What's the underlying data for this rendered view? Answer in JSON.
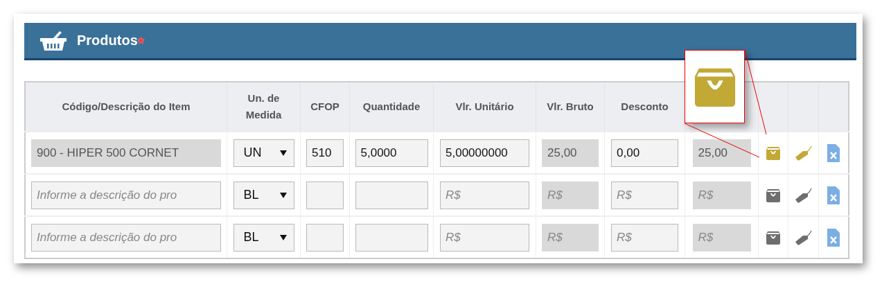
{
  "panel": {
    "title": "Produtos",
    "required_mark": "*"
  },
  "table": {
    "columns": [
      "Código/Descrição do Item",
      "Un. de Medida",
      "CFOP",
      "Quantidade",
      "Vlr. Unitário",
      "Vlr. Bruto",
      "Desconto"
    ],
    "rows": [
      {
        "highlighted": true,
        "description": {
          "value": "900 - HIPER 500 CORNET",
          "disabled": true
        },
        "unit": "UN",
        "cfop": {
          "value": "510"
        },
        "quantity": {
          "value": "5,0000"
        },
        "unit_price": {
          "value": "5,00000000"
        },
        "gross": {
          "value": "25,00"
        },
        "discount": {
          "value": "0,00"
        },
        "total": {
          "value": "25,00"
        }
      },
      {
        "highlighted": false,
        "description": {
          "placeholder": "Informe a descrição do pro",
          "disabled": false
        },
        "unit": "BL",
        "cfop": {},
        "quantity": {},
        "unit_price": {
          "placeholder": "R$"
        },
        "gross": {
          "placeholder": "R$"
        },
        "discount": {
          "placeholder": "R$"
        },
        "total": {
          "placeholder": "R$"
        }
      },
      {
        "highlighted": false,
        "description": {
          "placeholder": "Informe a descrição do pro",
          "disabled": false
        },
        "unit": "BL",
        "cfop": {},
        "quantity": {},
        "unit_price": {
          "placeholder": "R$"
        },
        "gross": {
          "placeholder": "R$"
        },
        "discount": {
          "placeholder": "R$"
        },
        "total": {
          "placeholder": "R$"
        }
      }
    ]
  }
}
